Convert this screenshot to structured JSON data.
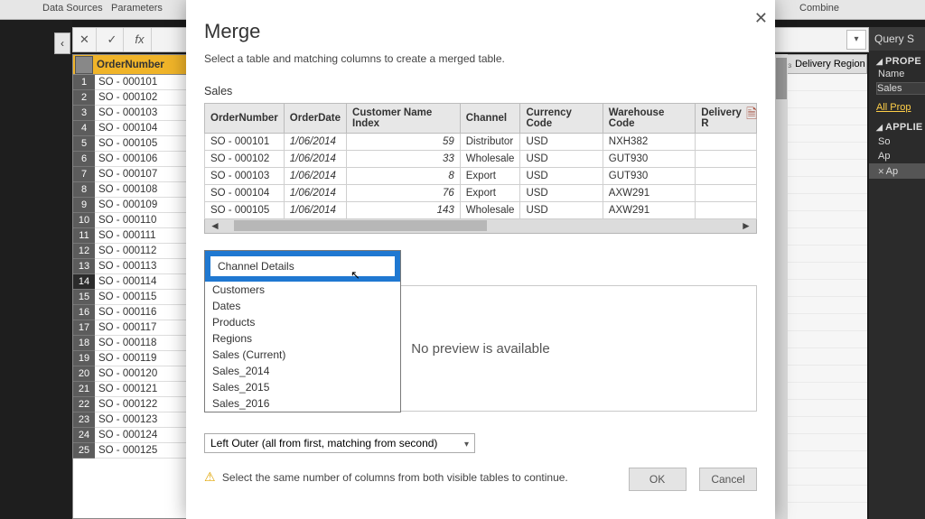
{
  "ribbon": {
    "data_sources": "Data Sources",
    "parameters": "Parameters",
    "combine": "Combine"
  },
  "fxbar": {
    "fx_label": "fx"
  },
  "left_grid": {
    "header": "OrderNumber",
    "rows": [
      "SO - 000101",
      "SO - 000102",
      "SO - 000103",
      "SO - 000104",
      "SO - 000105",
      "SO - 000106",
      "SO - 000107",
      "SO - 000108",
      "SO - 000109",
      "SO - 000110",
      "SO - 000111",
      "SO - 000112",
      "SO - 000113",
      "SO - 000114",
      "SO - 000115",
      "SO - 000116",
      "SO - 000117",
      "SO - 000118",
      "SO - 000119",
      "SO - 000120",
      "SO - 000121",
      "SO - 000122",
      "SO - 000123",
      "SO - 000124",
      "SO - 000125"
    ]
  },
  "delivery_header": {
    "icon": "1₂₃",
    "label": "Delivery Region"
  },
  "right_panel": {
    "title": "Query S",
    "prop_section": "PROPE",
    "name_label": "Name",
    "name_value": "Sales",
    "all_props": "All Prop",
    "steps_section": "APPLIE",
    "steps": [
      "So",
      "Ap",
      "Ap"
    ]
  },
  "dialog": {
    "title": "Merge",
    "subtitle": "Select a table and matching columns to create a merged table.",
    "first_table": "Sales",
    "columns": [
      "OrderNumber",
      "OrderDate",
      "Customer Name Index",
      "Channel",
      "Currency Code",
      "Warehouse Code",
      "Delivery R"
    ],
    "rows": [
      {
        "order": "SO - 000101",
        "date": "1/06/2014",
        "cni": "59",
        "channel": "Distributor",
        "cur": "USD",
        "wh": "NXH382",
        "dr": ""
      },
      {
        "order": "SO - 000102",
        "date": "1/06/2014",
        "cni": "33",
        "channel": "Wholesale",
        "cur": "USD",
        "wh": "GUT930",
        "dr": ""
      },
      {
        "order": "SO - 000103",
        "date": "1/06/2014",
        "cni": "8",
        "channel": "Export",
        "cur": "USD",
        "wh": "GUT930",
        "dr": ""
      },
      {
        "order": "SO - 000104",
        "date": "1/06/2014",
        "cni": "76",
        "channel": "Export",
        "cur": "USD",
        "wh": "AXW291",
        "dr": ""
      },
      {
        "order": "SO - 000105",
        "date": "1/06/2014",
        "cni": "143",
        "channel": "Wholesale",
        "cur": "USD",
        "wh": "AXW291",
        "dr": ""
      }
    ],
    "dropdown_options": [
      "Channel Details",
      "Customers",
      "Dates",
      "Products",
      "Regions",
      "Sales (Current)",
      "Sales_2014",
      "Sales_2015",
      "Sales_2016"
    ],
    "no_preview": "No preview is available",
    "join_kind": "Left Outer (all from first, matching from second)",
    "warning": "Select the same number of columns from both visible tables to continue.",
    "ok": "OK",
    "cancel": "Cancel"
  }
}
